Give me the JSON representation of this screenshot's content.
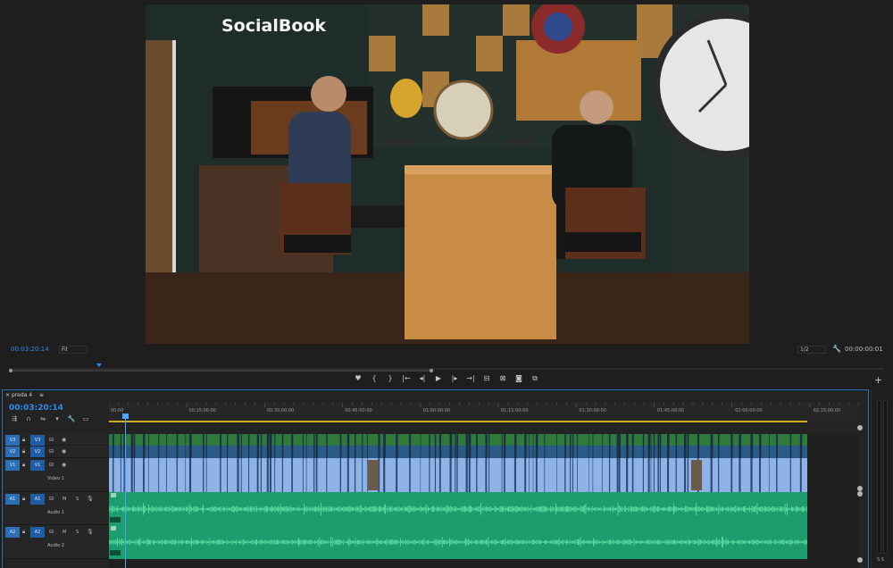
{
  "monitor": {
    "timecode": "00:03:20:14",
    "fit": "Fit",
    "resolution": "1/2",
    "duration": "00:00:00:01",
    "video": {
      "neon_sign": "SocialBook",
      "colors": {
        "wall": "#1f2d2a",
        "wood_panel": "#b07a36",
        "desk": "#c98c47",
        "floor": "#3a2618"
      }
    }
  },
  "transport": {
    "icons": [
      "marker-icon",
      "mark-in-icon",
      "mark-out-icon",
      "go-to-in-icon",
      "step-back-icon",
      "play-icon",
      "step-forward-icon",
      "go-to-out-icon",
      "lift-icon",
      "extract-icon",
      "camera-icon",
      "compare-icon"
    ],
    "glyphs": [
      "♥",
      "{",
      "}",
      "|←",
      "◂|",
      "▶",
      "|▸",
      "→|",
      "⊟",
      "⊠",
      "◙",
      "⧉"
    ],
    "add": "+"
  },
  "timeline": {
    "sequence_name": "preda 4",
    "menu_glyph": "≡",
    "timecode": "00:03:20:14",
    "ruler": [
      "00:00",
      "00:15:00:00",
      "00:30:00:00",
      "00:45:00:00",
      "01:00:00:00",
      "01:15:00:00",
      "01:30:00:00",
      "01:45:00:00",
      "02:00:00:00",
      "02:15:00:00"
    ],
    "tools": [
      "⇶",
      "∩",
      "⇋",
      "▾",
      "🔧",
      "▭"
    ],
    "tracks": [
      {
        "patch": "V3",
        "source": "V3",
        "name": "",
        "type": "video-small"
      },
      {
        "patch": "V2",
        "source": "V2",
        "name": "",
        "type": "video-small"
      },
      {
        "patch": "V1",
        "source": "V1",
        "name": "Video 1",
        "type": "video"
      },
      {
        "patch": "A1",
        "source": "A1",
        "name": "Audio 1",
        "type": "audio"
      },
      {
        "patch": "A2",
        "source": "A2",
        "name": "Audio 2",
        "type": "audio"
      }
    ],
    "audio_buttons": {
      "mute": "M",
      "solo": "S"
    },
    "colors": {
      "video_clip": "#8fb3e6",
      "video_top": "#2f7a3a",
      "audio_clip": "#1d9c6e",
      "wave": "#5ee6a8",
      "accent": "#2d8ceb",
      "work_area": "#c9b020"
    }
  },
  "meters": {
    "label": "S S"
  }
}
